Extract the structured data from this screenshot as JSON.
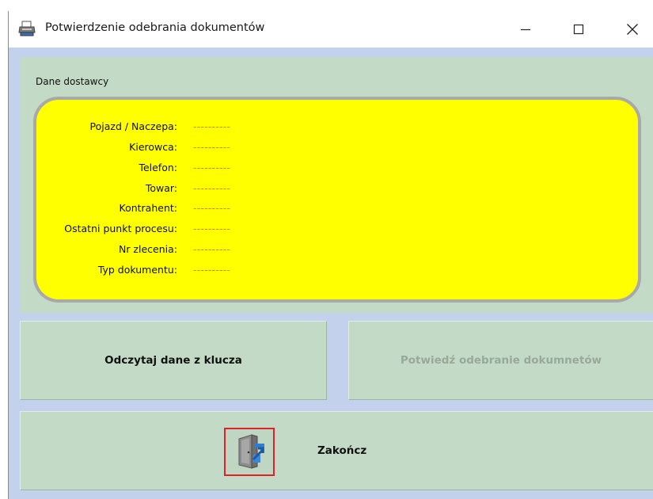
{
  "window": {
    "title": "Potwierdzenie odebrania dokumentów",
    "icon": "printer-icon"
  },
  "title_buttons": {
    "minimize": "—",
    "maximize": "☐",
    "close": "✕"
  },
  "supplier": {
    "label": "Dane dostawcy",
    "fields": [
      {
        "label": "Pojazd / Naczepa:",
        "value": "----------"
      },
      {
        "label": "Kierowca:",
        "value": "----------"
      },
      {
        "label": "Telefon:",
        "value": "----------"
      },
      {
        "label": "Towar:",
        "value": "----------"
      },
      {
        "label": "Kontrahent:",
        "value": "----------"
      },
      {
        "label": "Ostatni punkt procesu:",
        "value": "----------"
      },
      {
        "label": "Nr zlecenia:",
        "value": "----------"
      },
      {
        "label": "Typ dokumentu:",
        "value": "----------"
      }
    ]
  },
  "buttons": {
    "read_key": "Odczytaj dane z klucza",
    "confirm": "Potwiedź odebranie dokumnetów",
    "finish": "Zakończ"
  },
  "colors": {
    "client_bg": "#c3d1ec",
    "panel_bg": "#c3dbc6",
    "info_box": "#ffff00",
    "value_text": "#d08800",
    "disabled_text": "#98a89b",
    "exit_icon_border": "#e0202a"
  },
  "icons": {
    "exit": "exit-door-icon"
  }
}
